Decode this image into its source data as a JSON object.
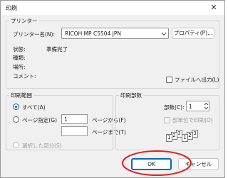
{
  "window": {
    "title": "印刷",
    "close_glyph": "✕"
  },
  "printer": {
    "group_label": "プリンター",
    "name_label": "プリンター名(N):",
    "name_value": "RICOH MP C5504 JPN",
    "properties_button": "プロパティ(P)...",
    "status_label": "状態:",
    "status_value": "準備完了",
    "type_label": "種類:",
    "location_label": "場所:",
    "comment_label": "コメント:",
    "print_to_file": "ファイルへ出力(L)"
  },
  "range": {
    "group_label": "印刷範囲",
    "all": "すべて(A)",
    "pages": "ページ指定(G)",
    "from_value": "1",
    "from_label": "ページから(F)",
    "to_label": "ページまで(T)",
    "selection": "選択した部分(S)"
  },
  "copies": {
    "group_label": "印刷部数",
    "count_label": "部数(C):",
    "count_value": "1",
    "collate": "部単位で印刷(O)",
    "collate_icon_numbers": [
      "1",
      "2",
      "3",
      "1",
      "2",
      "3"
    ]
  },
  "actions": {
    "ok": "OK",
    "cancel": "キャンセル"
  },
  "annotation": {
    "circle_color": "#e02020"
  }
}
